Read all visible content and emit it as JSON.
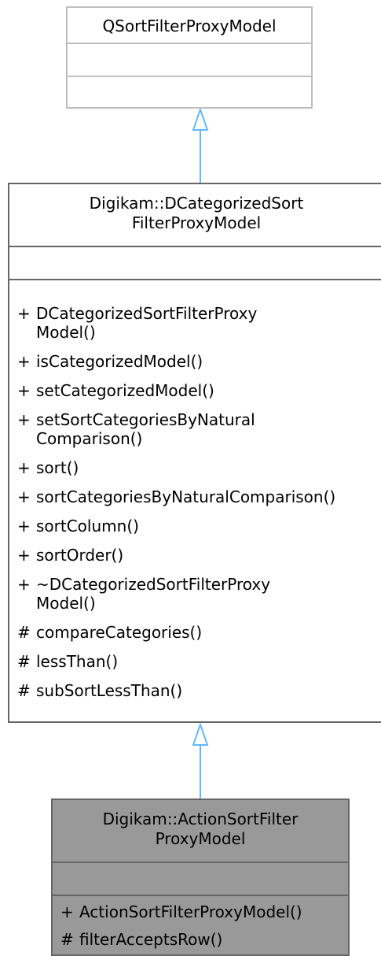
{
  "colors": {
    "edge": "#63b8ff",
    "top_border": "#bfbfbf",
    "border": "#666666",
    "highlight_fill": "#999999"
  },
  "classes": {
    "base": {
      "title": "QSortFilterProxyModel"
    },
    "middle": {
      "title_line1": "Digikam::DCategorizedSort",
      "title_line2": "FilterProxyModel",
      "members": [
        {
          "vis": "+",
          "name": "DCategorizedSortFilterProxy\nModel()"
        },
        {
          "vis": "+",
          "name": "isCategorizedModel()"
        },
        {
          "vis": "+",
          "name": "setCategorizedModel()"
        },
        {
          "vis": "+",
          "name": "setSortCategoriesByNatural\nComparison()"
        },
        {
          "vis": "+",
          "name": "sort()"
        },
        {
          "vis": "+",
          "name": "sortCategoriesByNaturalComparison()"
        },
        {
          "vis": "+",
          "name": "sortColumn()"
        },
        {
          "vis": "+",
          "name": "sortOrder()"
        },
        {
          "vis": "+",
          "name": "~DCategorizedSortFilterProxy\nModel()"
        },
        {
          "vis": "#",
          "name": "compareCategories()"
        },
        {
          "vis": "#",
          "name": "lessThan()"
        },
        {
          "vis": "#",
          "name": "subSortLessThan()"
        }
      ]
    },
    "derived": {
      "title_line1": "Digikam::ActionSortFilter",
      "title_line2": "ProxyModel",
      "members": [
        {
          "vis": "+",
          "name": "ActionSortFilterProxyModel()"
        },
        {
          "vis": "#",
          "name": "filterAcceptsRow()"
        }
      ]
    }
  }
}
